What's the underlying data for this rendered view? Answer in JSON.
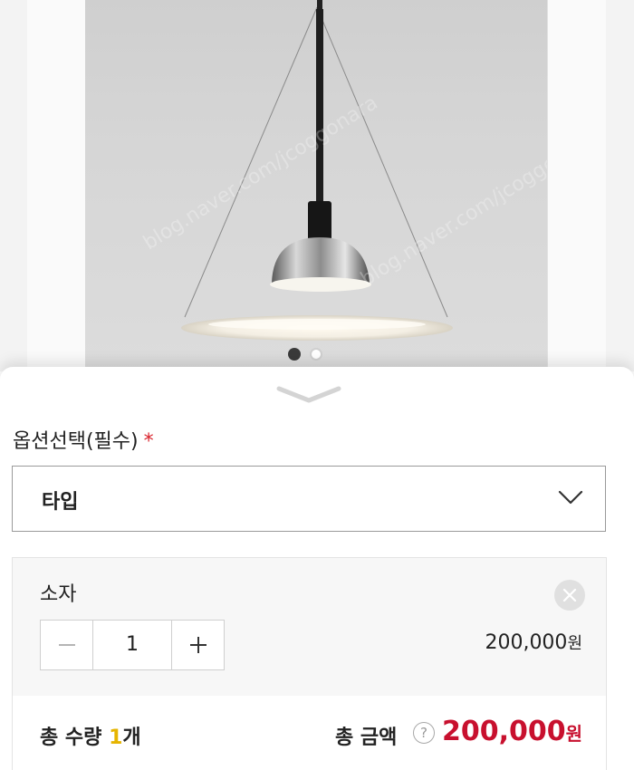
{
  "product": {
    "watermark": "blog.naver.com/jcoggonara",
    "carousel": {
      "current": 1,
      "total": 2
    }
  },
  "option": {
    "label": "옵션선택(필수)",
    "required_mark": "*",
    "selected_value": "타입"
  },
  "item": {
    "name": "소자",
    "quantity": "1",
    "price": "200,000",
    "currency": "원"
  },
  "total": {
    "qty_prefix": "총 수량",
    "qty_value": "1",
    "qty_suffix": "개",
    "amount_label": "총 금액",
    "help": "?",
    "amount": "200,000",
    "currency": "원"
  },
  "colors": {
    "accent_price": "#c8102e",
    "qty_highlight": "#e6b400",
    "required": "#d9232d"
  },
  "icons": {
    "handle": "chevron-down-icon",
    "select": "chevron-down-icon",
    "remove": "close-icon",
    "minus": "minus-icon",
    "plus": "plus-icon",
    "help": "question-icon"
  }
}
